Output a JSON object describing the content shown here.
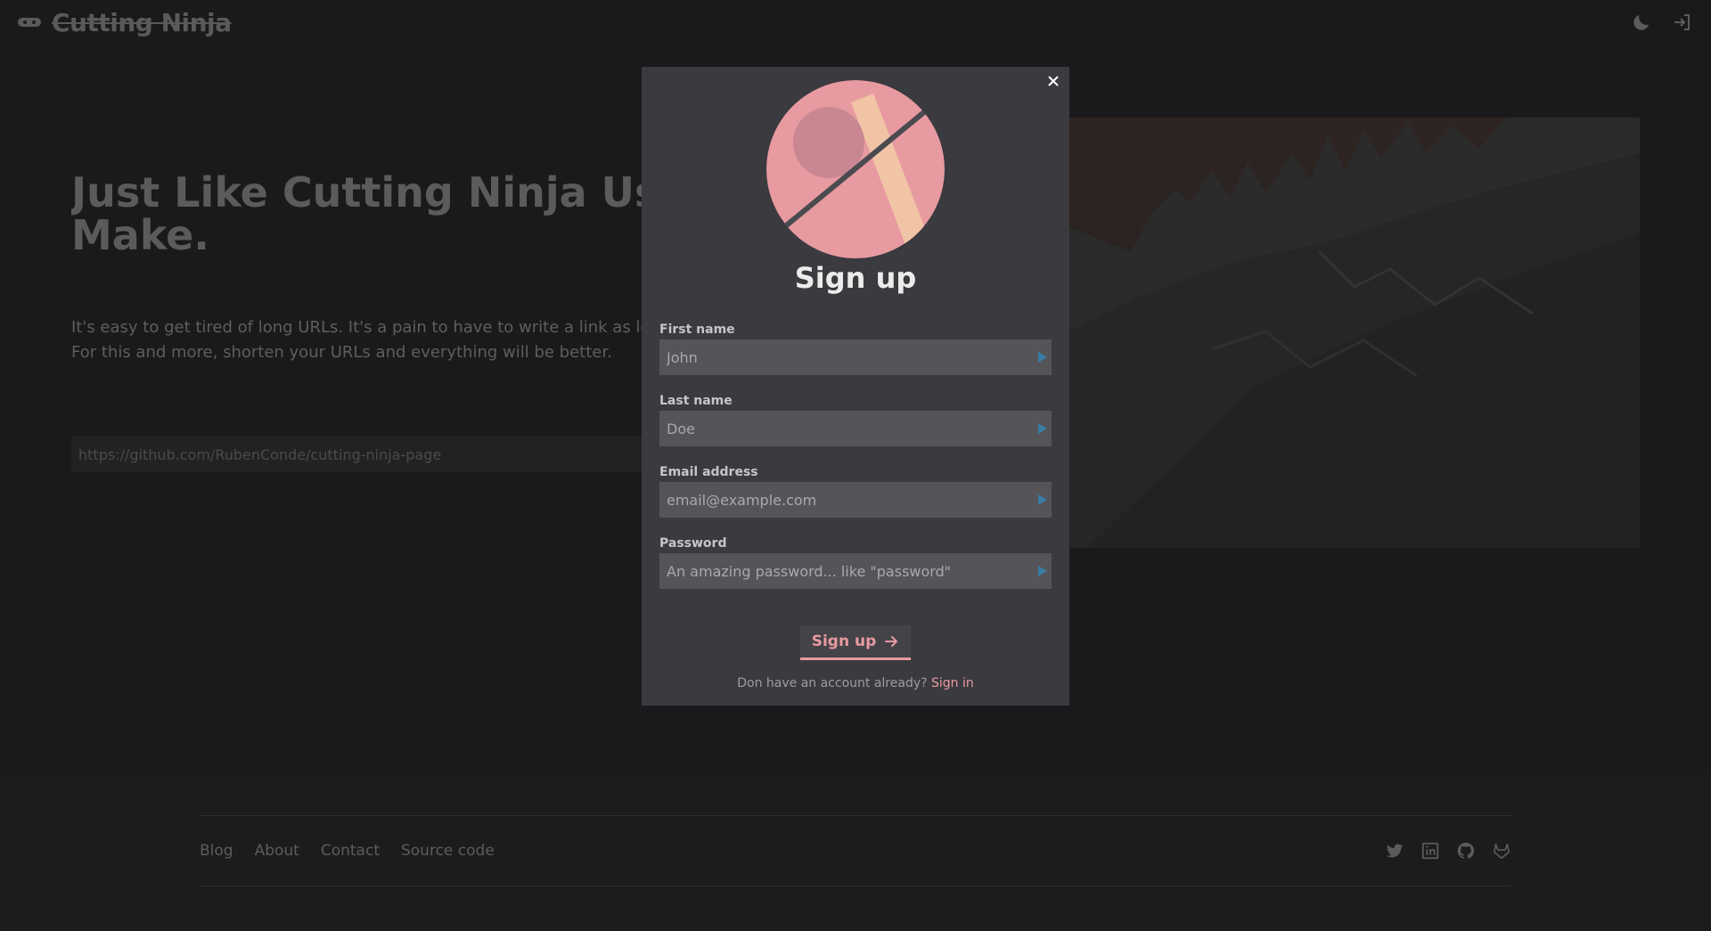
{
  "header": {
    "brand": "Cutting Ninja",
    "theme_icon": "moon-icon",
    "login_icon": "login-icon"
  },
  "hero": {
    "title_line1": "Just Like Cutting Ninja Use",
    "title_line2": "Make.",
    "desc_line1": "It's easy to get tired of long URLs. It's a pain to have to write a link as long",
    "desc_line2": "For this and more, shorten your URLs and everything will be better.",
    "url_placeholder": "https://github.com/RubenConde/cutting-ninja-page"
  },
  "modal": {
    "title": "Sign up",
    "close_icon": "close-icon",
    "fields": [
      {
        "label": "First name",
        "placeholder": "John",
        "type": "text"
      },
      {
        "label": "Last name",
        "placeholder": "Doe",
        "type": "text"
      },
      {
        "label": "Email address",
        "placeholder": "email@example.com",
        "type": "email"
      },
      {
        "label": "Password",
        "placeholder": "An amazing password... like \"password\"",
        "type": "password"
      }
    ],
    "submit_label": "Sign up",
    "signin_prompt": "Don have an account already?",
    "signin_link": "Sign in"
  },
  "footer": {
    "links": [
      "Blog",
      "About",
      "Contact",
      "Source code"
    ],
    "social_icons": [
      "twitter-icon",
      "linkedin-icon",
      "github-icon",
      "gitlab-icon"
    ]
  },
  "colors": {
    "accent": "#e89aa1",
    "modal_bg": "#3b3a3f",
    "input_bg": "#555459",
    "page_bg": "#1a1a1c"
  }
}
